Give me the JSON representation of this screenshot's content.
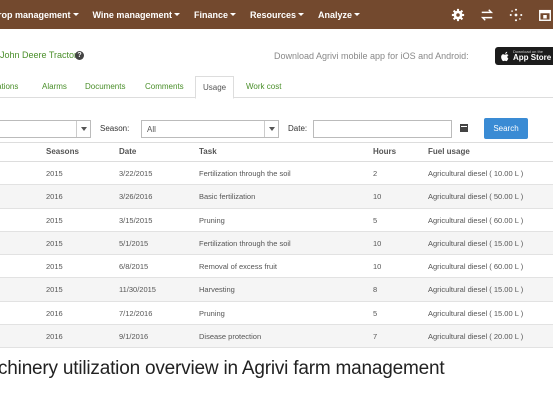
{
  "nav": {
    "items": [
      "rop management",
      "Wine management",
      "Finance",
      "Resources",
      "Analyze"
    ],
    "icons": [
      "gear-icon",
      "switch-arrows-icon",
      "sync-icon",
      "calendar-icon"
    ]
  },
  "header": {
    "title": "John Deere Tractor",
    "download_text": "Download Agrivi mobile app for iOS and Android:",
    "appstore_small": "Download on the",
    "appstore_big": "App Store"
  },
  "tabs": [
    "ations",
    "Alarms",
    "Documents",
    "Comments",
    "Usage",
    "Work cost"
  ],
  "active_tab": "Usage",
  "filters": {
    "season_label": "Season:",
    "season_value": "All",
    "date_label": "Date:",
    "date_value": "",
    "search_label": "Search"
  },
  "table": {
    "columns": [
      "Seasons",
      "Date",
      "Task",
      "Hours",
      "Fuel usage"
    ],
    "rows": [
      [
        "2015",
        "3/22/2015",
        "Fertilization through the soil",
        "2",
        "Agricultural diesel ( 10.00 L )"
      ],
      [
        "2016",
        "3/26/2016",
        "Basic fertilization",
        "10",
        "Agricultural diesel ( 50.00 L )"
      ],
      [
        "2015",
        "3/15/2015",
        "Pruning",
        "5",
        "Agricultural diesel ( 60.00 L )"
      ],
      [
        "2015",
        "5/1/2015",
        "Fertilization through the soil",
        "10",
        "Agricultural diesel ( 15.00 L )"
      ],
      [
        "2015",
        "6/8/2015",
        "Removal of excess fruit",
        "10",
        "Agricultural diesel ( 60.00 L )"
      ],
      [
        "2015",
        "11/30/2015",
        "Harvesting",
        "8",
        "Agricultural diesel ( 15.00 L )"
      ],
      [
        "2016",
        "7/12/2016",
        "Pruning",
        "5",
        "Agricultural diesel ( 15.00 L )"
      ],
      [
        "2016",
        "9/1/2016",
        "Disease protection",
        "7",
        "Agricultural diesel ( 20.00 L )"
      ]
    ]
  },
  "caption": "chinery utilization overview in Agrivi farm management",
  "colors": {
    "topbar": "#73492e",
    "link": "#4a8f2a",
    "button": "#3a8bd4"
  }
}
